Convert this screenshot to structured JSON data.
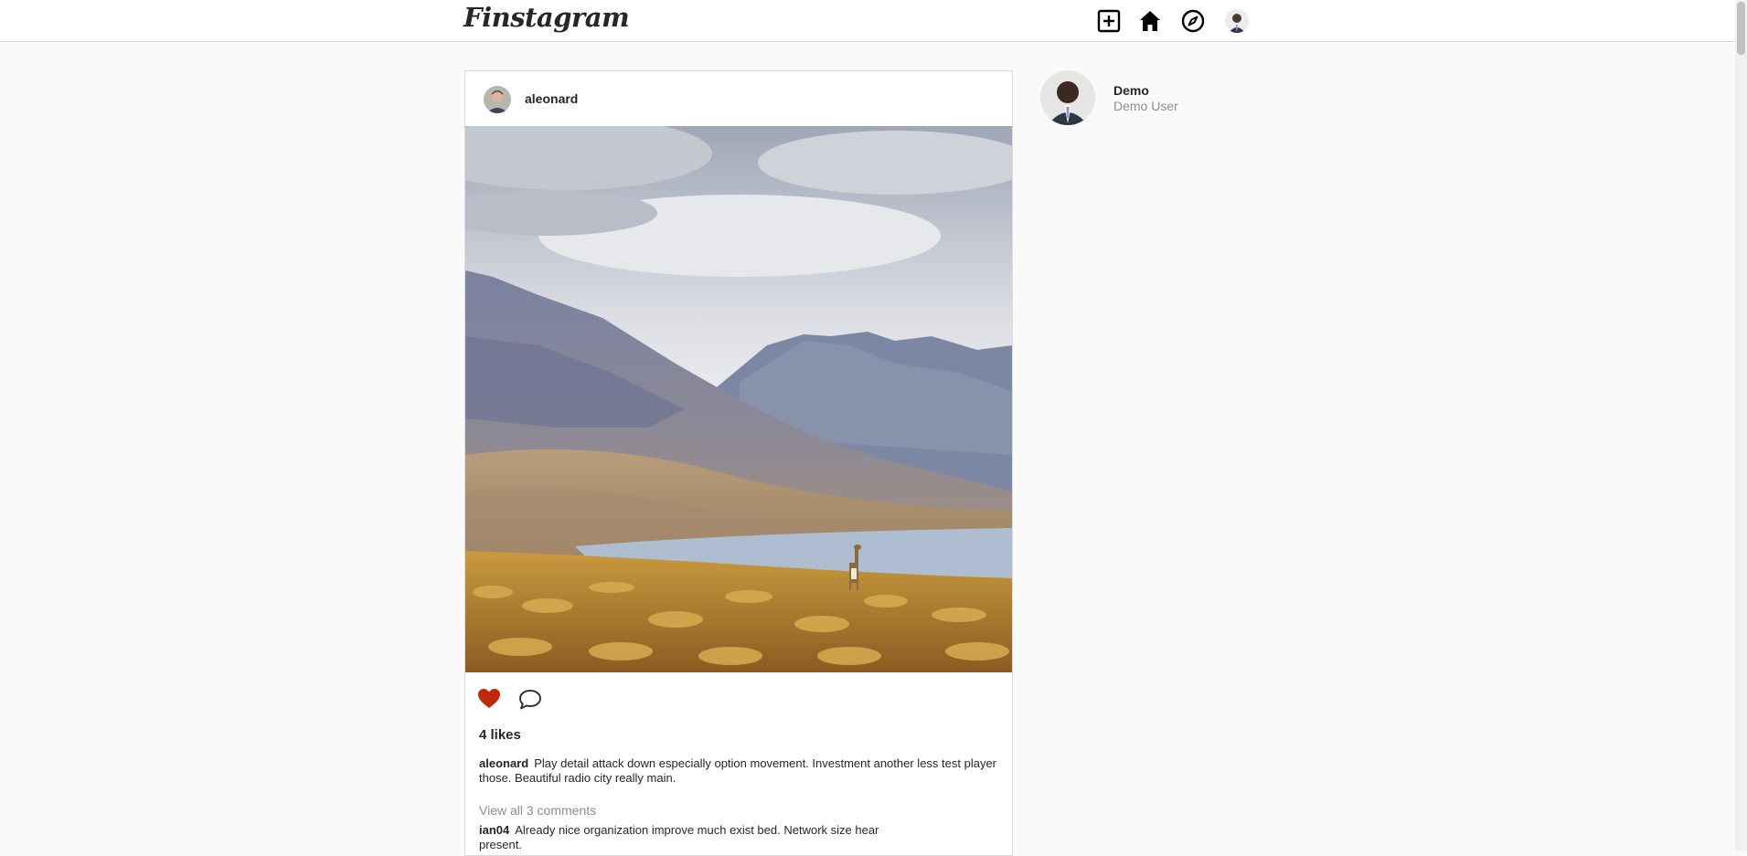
{
  "app": {
    "logo_text": "Finstagram"
  },
  "nav": {
    "icons": [
      "new-post-icon",
      "home-icon",
      "explore-compass-icon"
    ],
    "avatar": "user-avatar"
  },
  "post": {
    "username": "aleonard",
    "avatar": "avatar",
    "image": "landscape-photo-mountains-lake-vicuna",
    "liked": true,
    "like_color": "#c0280d",
    "likes_text": "4 likes",
    "caption_user": "aleonard",
    "caption_text": "Play detail attack down especially option movement. Investment another less test player those. Beautiful radio city really main.",
    "view_all_comments": "View all 3 comments",
    "comments": [
      {
        "user": "ian04",
        "text": "Already nice organization improve much exist bed. Network size hear present."
      }
    ]
  },
  "profile": {
    "username": "Demo",
    "full_name": "Demo User"
  }
}
